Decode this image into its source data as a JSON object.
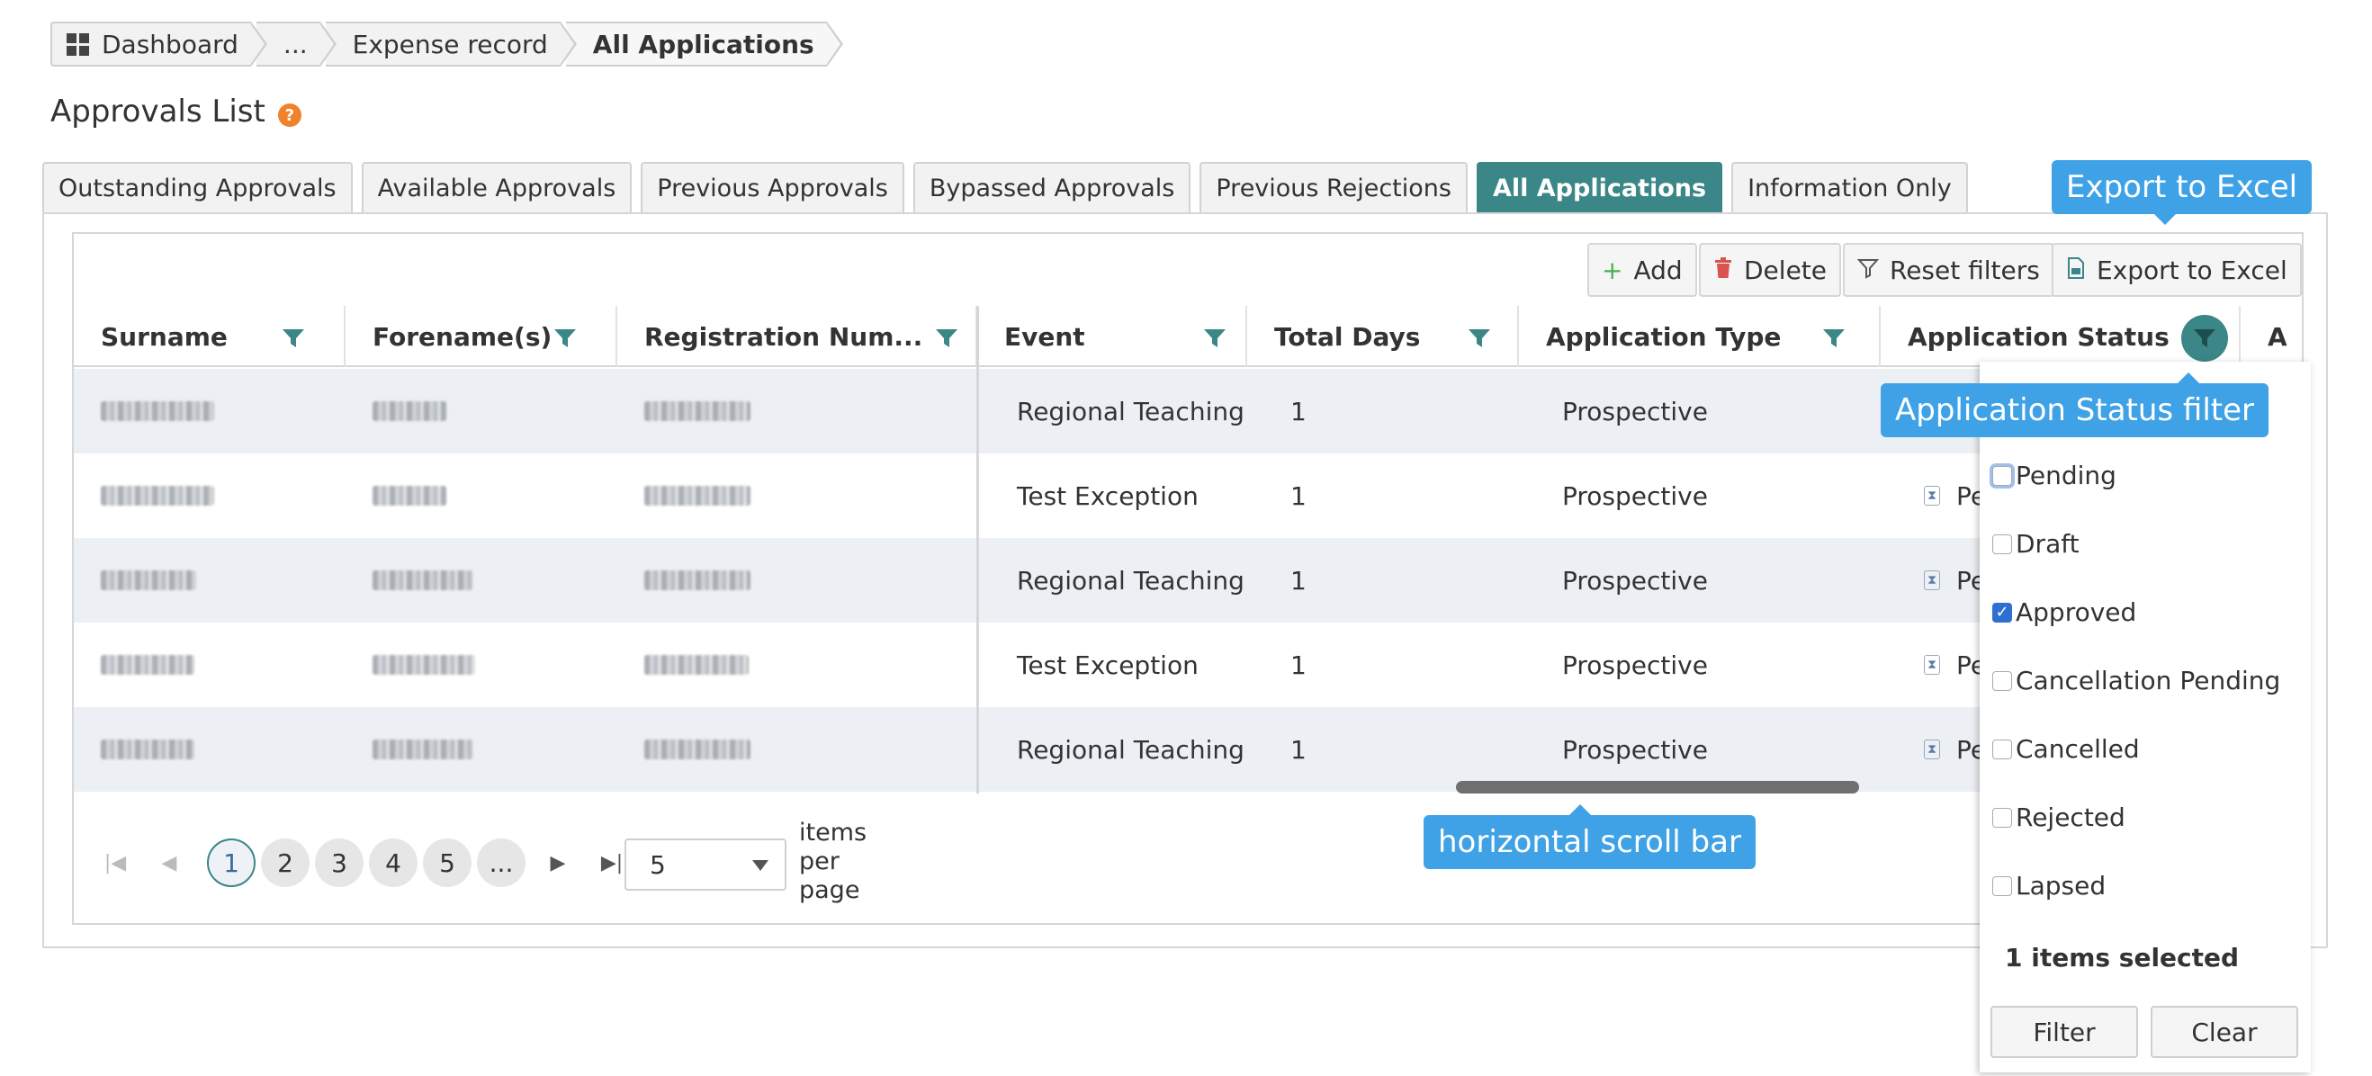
{
  "breadcrumb": {
    "items": [
      "Dashboard",
      "...",
      "Expense record",
      "All Applications"
    ]
  },
  "page": {
    "title": "Approvals List",
    "help": "?"
  },
  "tabs": [
    {
      "label": "Outstanding Approvals"
    },
    {
      "label": "Available Approvals"
    },
    {
      "label": "Previous Approvals"
    },
    {
      "label": "Bypassed Approvals"
    },
    {
      "label": "Previous Rejections"
    },
    {
      "label": "All Applications",
      "active": true
    },
    {
      "label": "Information Only"
    }
  ],
  "toolbar": {
    "add": "Add",
    "delete": "Delete",
    "reset_filters": "Reset filters",
    "export": "Export to Excel"
  },
  "columns": {
    "surname": "Surname",
    "forenames": "Forename(s)",
    "registration": "Registration Num...",
    "event": "Event",
    "total_days": "Total Days",
    "application_type": "Application Type",
    "application_status": "Application Status",
    "next": "A"
  },
  "rows": [
    {
      "event": "Regional Teaching",
      "total_days": "1",
      "application_type": "Prospective",
      "status": ""
    },
    {
      "event": "Test Exception",
      "total_days": "1",
      "application_type": "Prospective",
      "status": "Pe"
    },
    {
      "event": "Regional Teaching",
      "total_days": "1",
      "application_type": "Prospective",
      "status": "Pe"
    },
    {
      "event": "Test Exception",
      "total_days": "1",
      "application_type": "Prospective",
      "status": "Pe"
    },
    {
      "event": "Regional Teaching",
      "total_days": "1",
      "application_type": "Prospective",
      "status": "Pe"
    }
  ],
  "pager": {
    "pages": [
      "1",
      "2",
      "3",
      "4",
      "5",
      "..."
    ],
    "current": "1",
    "page_size": "5",
    "items_per_page_lines": [
      "items",
      "per",
      "page"
    ]
  },
  "status_filter": {
    "options": [
      {
        "label": "Pending",
        "checked": false
      },
      {
        "label": "Draft",
        "checked": false
      },
      {
        "label": "Approved",
        "checked": true
      },
      {
        "label": "Cancellation Pending",
        "checked": false
      },
      {
        "label": "Cancelled",
        "checked": false
      },
      {
        "label": "Rejected",
        "checked": false
      },
      {
        "label": "Lapsed",
        "checked": false
      }
    ],
    "selected_text": "1 items selected",
    "filter_label": "Filter",
    "clear_label": "Clear"
  },
  "callouts": {
    "export": "Export to Excel",
    "status_filter": "Application Status filter",
    "scrollbar": "horizontal scroll bar"
  },
  "colors": {
    "accent": "#3b8686",
    "callout": "#3fa2e6",
    "add_icon": "#4caf50",
    "delete_icon": "#d9534f",
    "help_icon": "#f0822a"
  },
  "icons": {
    "dashboard": "dashboard-grid-icon",
    "filter": "funnel-icon",
    "add": "plus-icon",
    "delete": "trash-icon",
    "export": "excel-file-icon",
    "status": "hourglass-icon"
  }
}
